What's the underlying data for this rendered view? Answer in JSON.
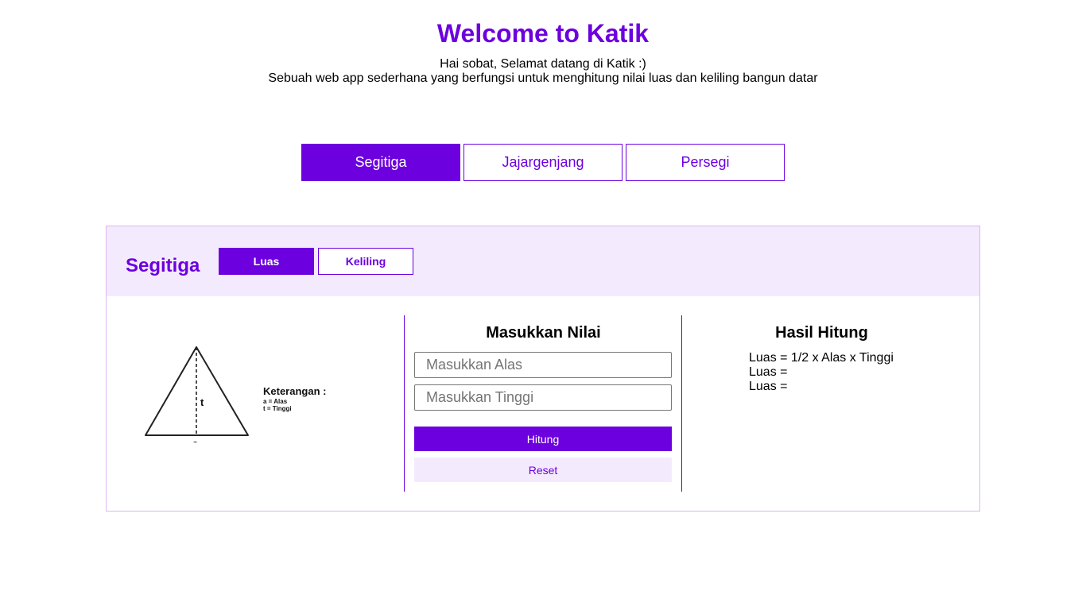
{
  "header": {
    "title": "Welcome to Katik",
    "subtitle_line1": "Hai sobat, Selamat datang di Katik :)",
    "subtitle_line2": "Sebuah web app sederhana yang berfungsi untuk menghitung nilai luas dan keliling bangun datar"
  },
  "shape_tabs": [
    {
      "label": "Segitiga",
      "active": true
    },
    {
      "label": "Jajargenjang",
      "active": false
    },
    {
      "label": "Persegi",
      "active": false
    }
  ],
  "panel": {
    "title": "Segitiga",
    "mode_tabs": [
      {
        "label": "Luas",
        "active": true
      },
      {
        "label": "Keliling",
        "active": false
      }
    ]
  },
  "illustration": {
    "height_label": "t",
    "base_label": "a",
    "legend_title": "Keterangan :",
    "legend_lines": [
      "a = Alas",
      "t  = Tinggi"
    ]
  },
  "input_section": {
    "title": "Masukkan Nilai",
    "alas_value": "",
    "alas_placeholder": "Masukkan Alas",
    "tinggi_value": "",
    "tinggi_placeholder": "Masukkan Tinggi",
    "hitung_label": "Hitung",
    "reset_label": "Reset"
  },
  "result_section": {
    "title": "Hasil Hitung",
    "lines": [
      "Luas = 1/2 x Alas x Tinggi",
      "Luas =",
      "Luas ="
    ]
  },
  "colors": {
    "accent": "#6c00df",
    "panel_background": "#f4eafd",
    "panel_border": "#d6b8f0"
  }
}
